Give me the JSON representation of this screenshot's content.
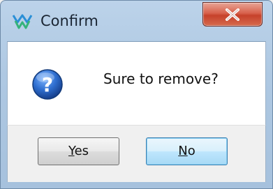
{
  "window": {
    "title": "Confirm",
    "close_glyph": "X",
    "app_icon": "app-logo-icon"
  },
  "dialog": {
    "icon": "question-icon",
    "message": "Sure to remove?"
  },
  "buttons": {
    "yes": {
      "mnemonic": "Y",
      "rest": "es"
    },
    "no": {
      "mnemonic": "N",
      "rest": "o"
    }
  },
  "colors": {
    "close_button": "#c6412b",
    "question_icon": "#1f5fb8",
    "default_button_border": "#3c7fb1"
  }
}
